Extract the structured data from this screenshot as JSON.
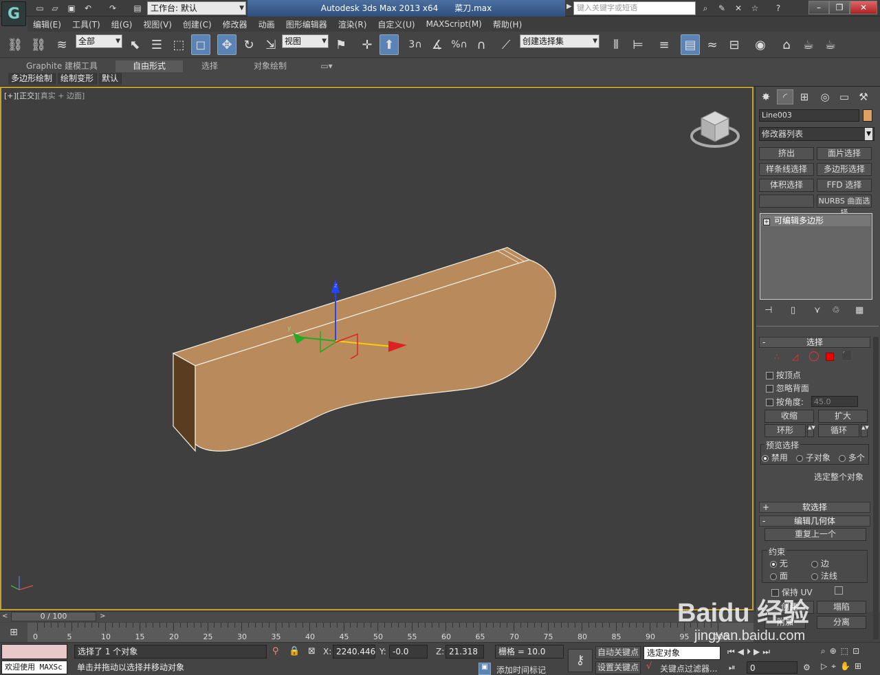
{
  "titlebar": {
    "workspace_label": "工作台: 默认",
    "app_name": "Autodesk 3ds Max  2013 x64",
    "file_name": "菜刀.max",
    "search_placeholder": "键入关键字或短语"
  },
  "menu": [
    "编辑(E)",
    "工具(T)",
    "组(G)",
    "视图(V)",
    "创建(C)",
    "修改器",
    "动画",
    "图形编辑器",
    "渲染(R)",
    "自定义(U)",
    "MAXScript(M)",
    "帮助(H)"
  ],
  "toolbar": {
    "selection_filter": "全部",
    "reference_coord": "视图",
    "named_selection": "创建选择集",
    "snap_label": "3",
    "percent_label": "%"
  },
  "ribbon": {
    "tabs": [
      "Graphite 建模工具",
      "自由形式",
      "选择",
      "对象绘制"
    ],
    "subtabs": [
      "多边形绘制",
      "绘制变形",
      "默认"
    ]
  },
  "viewport": {
    "label_a": "[+]",
    "label_b": "[正交]",
    "label_c": "[真实 + 边面]",
    "axis_x": "x",
    "axis_y": "y",
    "axis_z": "z"
  },
  "command_panel": {
    "object_name": "Line003",
    "object_color": "#e0a060",
    "modifier_list": "修改器列表",
    "modifier_buttons": [
      "挤出",
      "面片选择",
      "样条线选择",
      "多边形选择",
      "体积选择",
      "FFD 选择",
      "",
      "NURBS 曲面选择"
    ],
    "stack_item": "可编辑多边形",
    "selection_rollout": "选择",
    "by_vertex": "按顶点",
    "ignore_backfacing": "忽略背面",
    "by_angle": "按角度:",
    "angle_value": "45.0",
    "shrink": "收缩",
    "grow": "扩大",
    "ring": "环形",
    "loop": "循环",
    "preview_selection": "预览选择",
    "preview_options": [
      "禁用",
      "子对象",
      "多个"
    ],
    "select_whole": "选定整个对象",
    "soft_selection": "软选择",
    "edit_geometry": "编辑几何体",
    "repeat_last": "重复上一个",
    "constraints": "约束",
    "constraint_options": [
      "无",
      "边",
      "面",
      "法线"
    ],
    "preserve_uv": "保持 UV",
    "create": "创建",
    "collapse": "塌陷",
    "attach": "附加",
    "detach": "分离"
  },
  "timeline": {
    "frame_display": "0 / 100",
    "ticks": [
      "0",
      "5",
      "10",
      "15",
      "20",
      "25",
      "30",
      "35",
      "40",
      "45",
      "50",
      "55",
      "60",
      "65",
      "70",
      "75",
      "80",
      "85",
      "90",
      "95",
      "100"
    ]
  },
  "status": {
    "welcome": "欢迎使用 MAXSc",
    "selected": "选择了 1 个对象",
    "hint": "单击并拖动以选择并移动对象",
    "x_label": "X:",
    "x_value": "2240.446",
    "y_label": "Y:",
    "y_value": "-0.0",
    "z_label": "Z:",
    "z_value": "21.318",
    "grid": "栅格 = 10.0",
    "add_time_tag": "添加时间标记",
    "auto_key": "自动关键点",
    "set_key": "设置关键点",
    "selected_object": "选定对象",
    "key_filters": "关键点过滤器...",
    "current_frame": "0"
  },
  "watermark": {
    "brand": "Baidu 经验",
    "url": "jingyan.baidu.com"
  }
}
